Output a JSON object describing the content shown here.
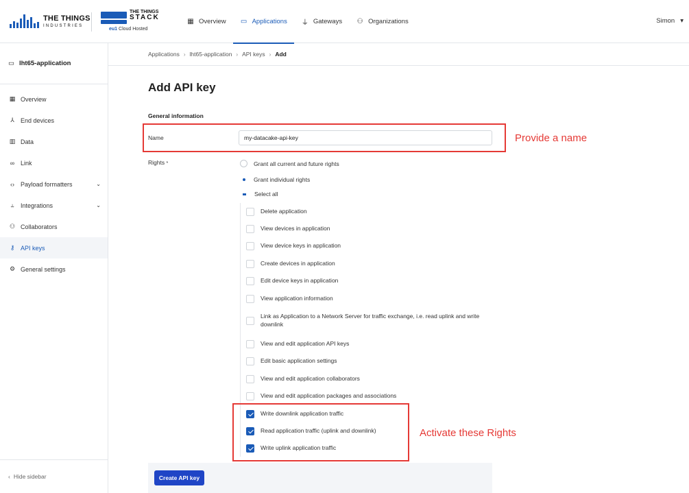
{
  "header": {
    "tti_logo": {
      "line1": "THE THINGS",
      "line2": "INDUSTRIES"
    },
    "tts_logo": {
      "line1": "THE THINGS",
      "line2": "STACK",
      "region": "eu1",
      "hosting": "Cloud Hosted"
    },
    "nav": [
      {
        "label": "Overview",
        "icon": "grid-icon"
      },
      {
        "label": "Applications",
        "icon": "window-icon",
        "active": true
      },
      {
        "label": "Gateways",
        "icon": "gateway-icon"
      },
      {
        "label": "Organizations",
        "icon": "people-icon"
      }
    ],
    "user": {
      "name": "Simon",
      "caret": "▾"
    }
  },
  "sidebar": {
    "app_name": "lht65-application",
    "items": [
      {
        "label": "Overview",
        "icon": "grid-icon"
      },
      {
        "label": "End devices",
        "icon": "device-tree-icon"
      },
      {
        "label": "Data",
        "icon": "data-icon"
      },
      {
        "label": "Link",
        "icon": "link-icon"
      },
      {
        "label": "Payload formatters",
        "icon": "code-icon",
        "expandable": true
      },
      {
        "label": "Integrations",
        "icon": "integration-icon",
        "expandable": true
      },
      {
        "label": "Collaborators",
        "icon": "people-icon"
      },
      {
        "label": "API keys",
        "icon": "key-icon",
        "active": true
      },
      {
        "label": "General settings",
        "icon": "gear-icon"
      }
    ],
    "hide_label": "Hide sidebar"
  },
  "breadcrumb": [
    "Applications",
    "lht65-application",
    "API keys",
    "Add"
  ],
  "main": {
    "title": "Add API key",
    "section": "General information",
    "name_label": "Name",
    "name_value": "my-datacake-api-key",
    "rights_label": "Rights",
    "required_mark": "*",
    "grant_all": "Grant all current and future rights",
    "grant_individual": "Grant individual rights",
    "select_all": "Select all",
    "rights": [
      {
        "label": "Delete application",
        "checked": false
      },
      {
        "label": "View devices in application",
        "checked": false
      },
      {
        "label": "View device keys in application",
        "checked": false
      },
      {
        "label": "Create devices in application",
        "checked": false
      },
      {
        "label": "Edit device keys in application",
        "checked": false
      },
      {
        "label": "View application information",
        "checked": false
      },
      {
        "label": "Link as Application to a Network Server for traffic exchange, i.e. read uplink and write downlink",
        "checked": false
      },
      {
        "label": "View and edit application API keys",
        "checked": false
      },
      {
        "label": "Edit basic application settings",
        "checked": false
      },
      {
        "label": "View and edit application collaborators",
        "checked": false
      },
      {
        "label": "View and edit application packages and associations",
        "checked": false
      },
      {
        "label": "Write downlink application traffic",
        "checked": true
      },
      {
        "label": "Read application traffic (uplink and downlink)",
        "checked": true
      },
      {
        "label": "Write uplink application traffic",
        "checked": true
      }
    ],
    "submit_label": "Create API key"
  },
  "annotations": {
    "name_note": "Provide a name",
    "rights_note": "Activate these Rights",
    "color": "#e53935"
  },
  "colors": {
    "accent": "#1a5bb7",
    "button": "#1f45c6"
  }
}
